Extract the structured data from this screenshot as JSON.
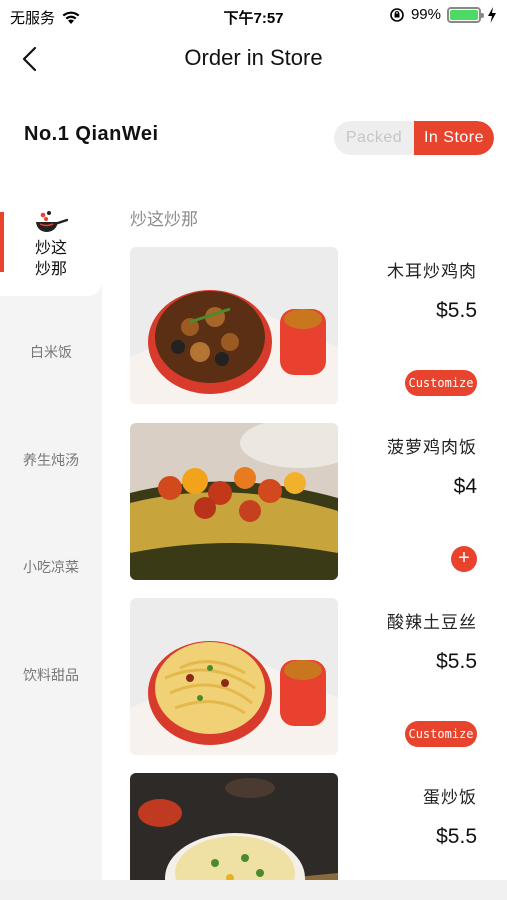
{
  "status_bar": {
    "carrier": "无服务",
    "time": "下午7:57",
    "battery_percent_label": "99%",
    "battery_level": 0.99
  },
  "nav": {
    "title": "Order in Store"
  },
  "store": {
    "name": "No.1 QianWei",
    "toggle": {
      "packed_label": "Packed",
      "in_store_label": "In Store",
      "selected": "In Store"
    }
  },
  "sidebar": {
    "active_category": "炒这炒那",
    "active_line1": "炒这",
    "active_line2": "炒那",
    "categories": [
      "白米饭",
      "养生炖汤",
      "小吃凉菜",
      "饮料甜品"
    ]
  },
  "menu": {
    "section_title": "炒这炒那",
    "items": [
      {
        "name": "木耳炒鸡肉",
        "price": "$5.5",
        "action": "Customize"
      },
      {
        "name": "菠萝鸡肉饭",
        "price": "$4",
        "action": "+"
      },
      {
        "name": "酸辣土豆丝",
        "price": "$5.5",
        "action": "Customize"
      },
      {
        "name": "蛋炒饭",
        "price": "$5.5",
        "action": ""
      }
    ]
  },
  "colors": {
    "accent": "#e8432d",
    "battery": "#4cd964"
  }
}
